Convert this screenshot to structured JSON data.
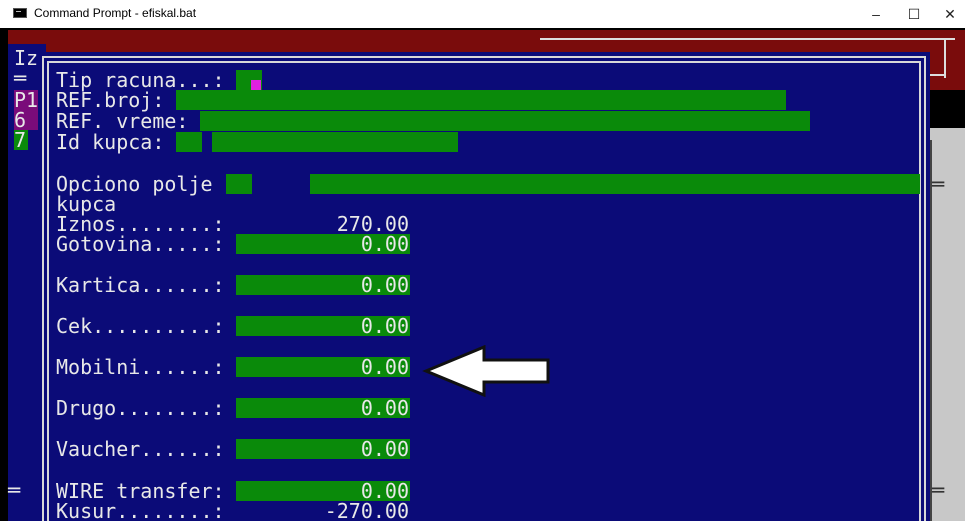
{
  "window": {
    "title": "Command Prompt - efiskal.bat",
    "minimize_glyph": "–",
    "maximize_glyph": "☐",
    "close_glyph": "✕",
    "icon": "console-icon"
  },
  "background": {
    "left_labels": [
      "Iz",
      "═",
      "P1",
      "6",
      "7"
    ]
  },
  "dialog": {
    "tip_racuna_label": "Tip racuna...:",
    "ref_broj_label": "REF.broj:",
    "ref_vreme_label": "REF. vreme:",
    "id_kupca_label": "Id kupca:",
    "opciono_label_1": "Opciono polje",
    "opciono_label_2": "kupca",
    "iznos_label": "Iznos........:",
    "iznos_value": "270.00",
    "gotovina_label": "Gotovina.....:",
    "gotovina_value": "0.00",
    "kartica_label": "Kartica......:",
    "kartica_value": "0.00",
    "cek_label": "Cek..........:",
    "cek_value": "0.00",
    "mobilni_label": "Mobilni......:",
    "mobilni_value": "0.00",
    "drugo_label": "Drugo........:",
    "drugo_value": "0.00",
    "vaucher_label": "Vaucher......:",
    "vaucher_value": "0.00",
    "wire_label": "WIRE transfer:",
    "wire_value": "0.00",
    "kusur_label": "Kusur........:",
    "kusur_value": "-270.00"
  },
  "colors": {
    "dialog_bg": "#0b0b78",
    "field_green": "#0a8a0a",
    "frame_maroon": "#7a0c0c",
    "magenta": "#e020e0",
    "arrow": "white-arrow-icon"
  }
}
